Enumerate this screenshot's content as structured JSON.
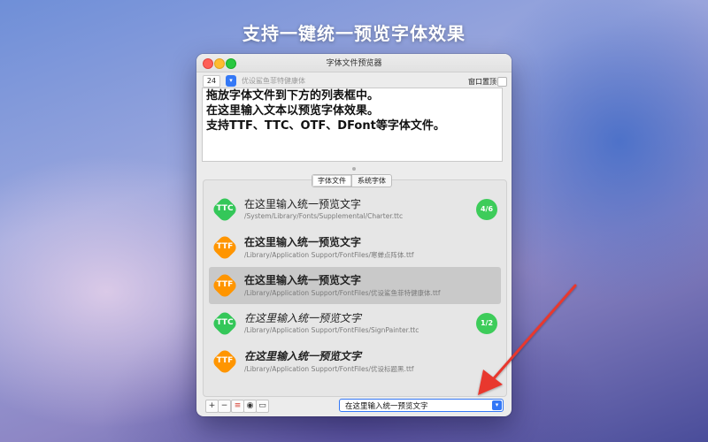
{
  "headline": "支持一键统一预览字体效果",
  "window": {
    "title": "字体文件预览器",
    "font_size": "24",
    "font_name": "优设鲨鱼菲特健康体",
    "always_on_top_label": "窗口置顶"
  },
  "text_area": {
    "lines": [
      "拖放字体文件到下方的列表框中。",
      "在这里输入文本以预览字体效果。",
      "支持TTF、TTC、OTF、DFont等字体文件。"
    ]
  },
  "tabs": [
    {
      "label": "字体文件",
      "active": true
    },
    {
      "label": "系统字体",
      "active": false
    }
  ],
  "font_list": [
    {
      "type": "TTC",
      "badge_color": "#34c759",
      "sample": "在这里输入统一预览文字",
      "path": "/System/Library/Fonts/Supplemental/Charter.ttc",
      "count": "4/6",
      "style": "serif",
      "selected": false
    },
    {
      "type": "TTF",
      "badge_color": "#ff9500",
      "sample": "在这里输入统一预览文字",
      "path": "/Library/Application Support/FontFiles/寒蝉点阵体.ttf",
      "count": "",
      "style": "bold",
      "selected": false
    },
    {
      "type": "TTF",
      "badge_color": "#ff9500",
      "sample": "在这里输入统一预览文字",
      "path": "/Library/Application Support/FontFiles/优设鲨鱼菲特健康体.ttf",
      "count": "",
      "style": "bold",
      "selected": true
    },
    {
      "type": "TTC",
      "badge_color": "#34c759",
      "sample": "在这里输入统一预览文字",
      "path": "/Library/Application Support/FontFiles/SignPainter.ttc",
      "count": "1/2",
      "style": "italic",
      "selected": false
    },
    {
      "type": "TTF",
      "badge_color": "#ff9500",
      "sample": "在这里输入统一预览文字",
      "path": "/Library/Application Support/FontFiles/优设标题黑.ttf",
      "count": "",
      "style": "bolditalic",
      "selected": false
    }
  ],
  "bottom_bar": {
    "buttons": [
      {
        "name": "add-icon",
        "glyph": "+"
      },
      {
        "name": "remove-icon",
        "glyph": "−"
      },
      {
        "name": "filter-icon",
        "glyph": "≡"
      },
      {
        "name": "eye-icon",
        "glyph": "◉"
      },
      {
        "name": "folder-icon",
        "glyph": "▭"
      }
    ],
    "preview_text": "在这里输入统一预览文字"
  },
  "colors": {
    "accent": "#3478f6",
    "ttc_green": "#34c759",
    "ttf_orange": "#ff9500",
    "count_green": "#3dcc5a",
    "arrow_red": "#e8372e"
  }
}
